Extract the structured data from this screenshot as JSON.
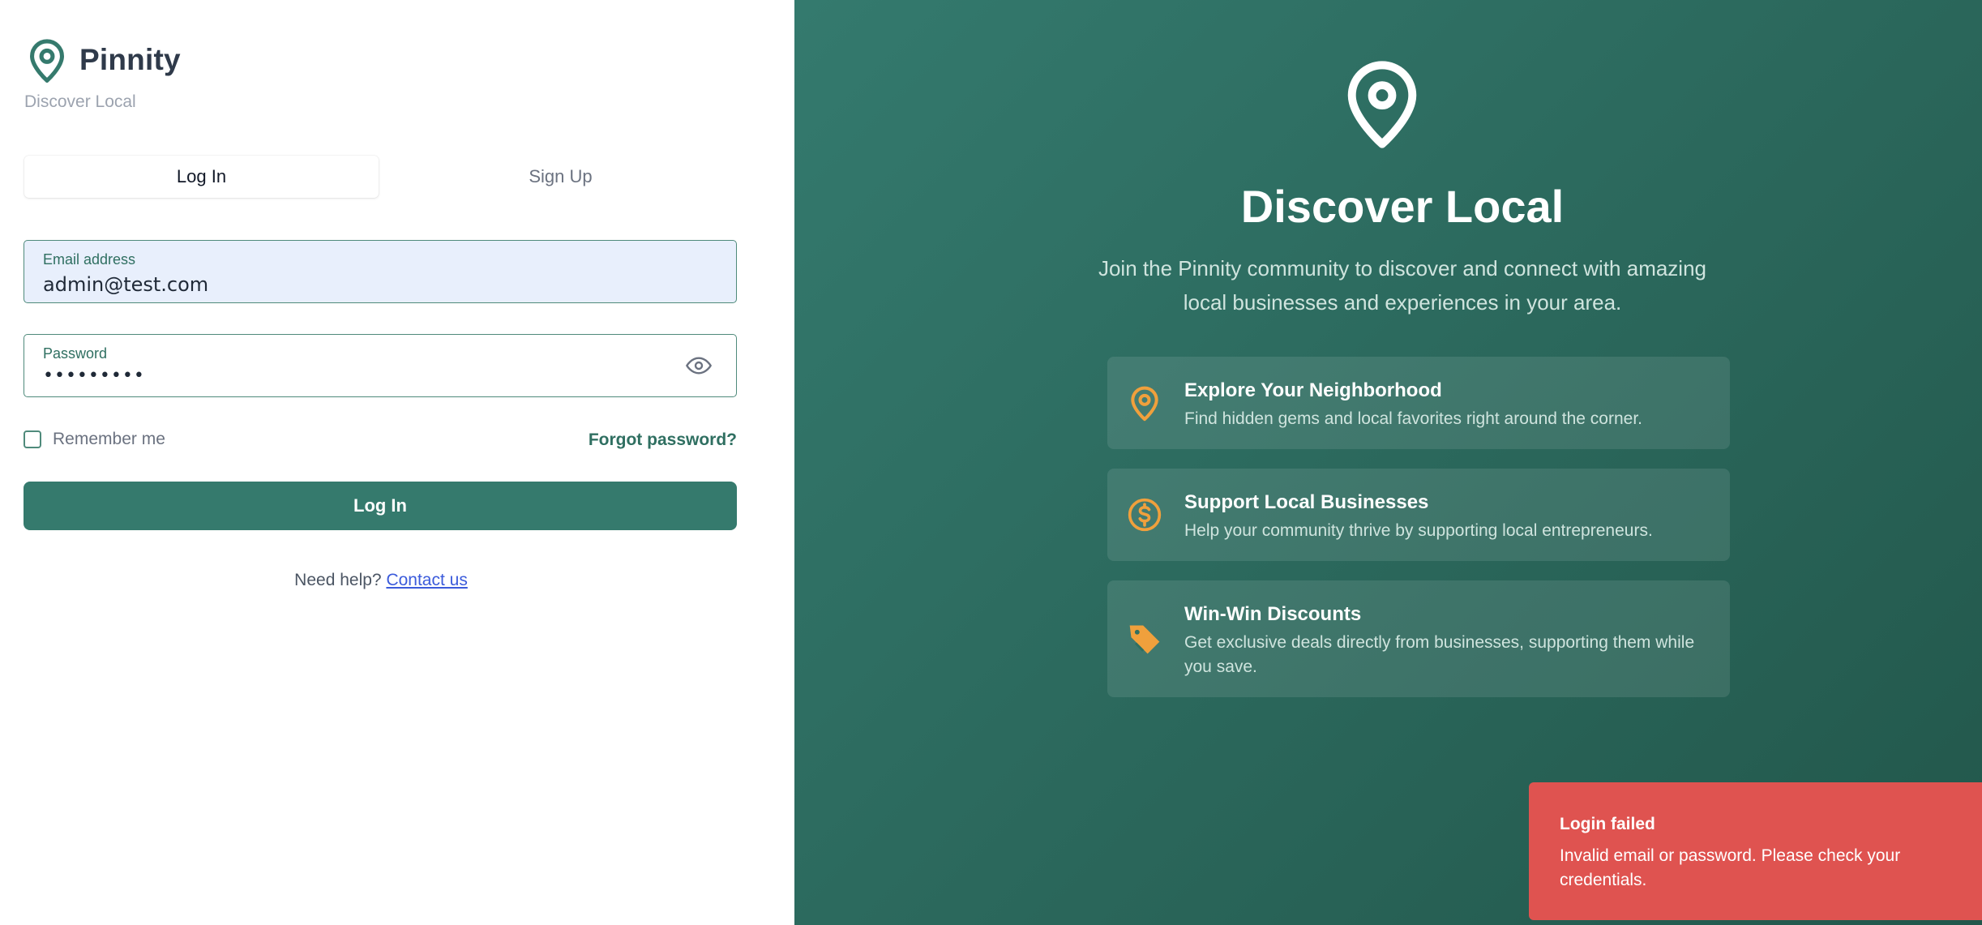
{
  "brand": {
    "name": "Pinnity",
    "tagline": "Discover Local"
  },
  "tabs": [
    {
      "label": "Log In",
      "active": true
    },
    {
      "label": "Sign Up",
      "active": false
    }
  ],
  "form": {
    "email": {
      "label": "Email address",
      "value": "admin@test.com"
    },
    "password": {
      "label": "Password",
      "value": "•••••••••"
    },
    "remember_label": "Remember me",
    "remember_checked": false,
    "forgot_label": "Forgot password?",
    "submit_label": "Log In",
    "help_text": "Need help?",
    "help_link": "Contact us"
  },
  "hero": {
    "title": "Discover Local",
    "subtitle": "Join the Pinnity community to discover and connect with amazing local businesses and experiences in your area.",
    "features": [
      {
        "icon": "map-pin-icon",
        "title": "Explore Your Neighborhood",
        "description": "Find hidden gems and local favorites right around the corner."
      },
      {
        "icon": "dollar-circle-icon",
        "title": "Support Local Businesses",
        "description": "Help your community thrive by supporting local entrepreneurs."
      },
      {
        "icon": "tag-icon",
        "title": "Win-Win Discounts",
        "description": "Get exclusive deals directly from businesses, supporting them while you save."
      }
    ]
  },
  "toast": {
    "title": "Login failed",
    "message": "Invalid email or password. Please check your credentials."
  },
  "colors": {
    "primary": "#357a6d",
    "accent": "#f0a03c",
    "error": "#df5350",
    "link": "#3b5bdb"
  }
}
